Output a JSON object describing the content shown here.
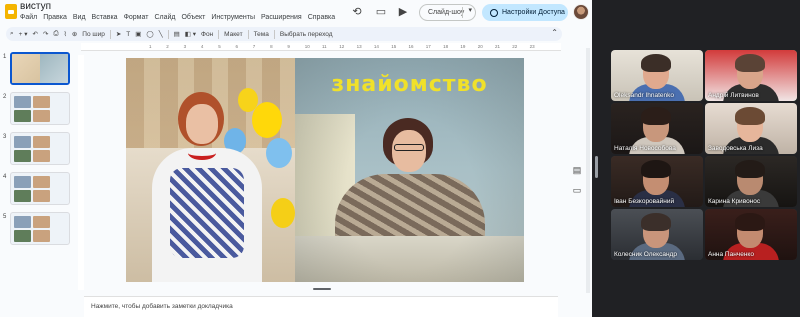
{
  "app": {
    "doc_title": "виступ",
    "menu": [
      "Файл",
      "Правка",
      "Вид",
      "Вставка",
      "Формат",
      "Слайд",
      "Объект",
      "Инструменты",
      "Расширения",
      "Справка"
    ],
    "slideshow_label": "Слайд-шоу",
    "share_label": "Настройки Доступа",
    "toolbar": {
      "zoom_label": "По шир",
      "background_label": "Фон",
      "layout_label": "Макет",
      "theme_label": "Тема",
      "transition_label": "Выбрать переход"
    },
    "ruler_ticks": [
      "1",
      "2",
      "3",
      "4",
      "5",
      "6",
      "7",
      "8",
      "9",
      "10",
      "11",
      "12",
      "13",
      "14",
      "15",
      "16",
      "17",
      "18",
      "19",
      "20",
      "21",
      "22",
      "23"
    ],
    "filmstrip": [
      {
        "num": "1"
      },
      {
        "num": "2"
      },
      {
        "num": "3"
      },
      {
        "num": "4"
      },
      {
        "num": "5"
      }
    ],
    "slide": {
      "title": "знайомство"
    },
    "notes_placeholder": "Нажмите, чтобы добавить заметки докладчика"
  },
  "call": {
    "participants": [
      {
        "name": "Oleksandr Ihnatenko"
      },
      {
        "name": "Андрій Литвинов"
      },
      {
        "name": "Наталія Новособова"
      },
      {
        "name": "Заводовська Лиза"
      },
      {
        "name": "Іван Безкоровайний"
      },
      {
        "name": "Карина Кривонос"
      },
      {
        "name": "Колесник Олександр"
      },
      {
        "name": "Анна Панченко"
      }
    ]
  },
  "colors": {
    "accent": "#0b57d0",
    "share_bg": "#c2e7ff",
    "slide_title": "#f0e12a",
    "active_speaker": "#5fd184"
  }
}
